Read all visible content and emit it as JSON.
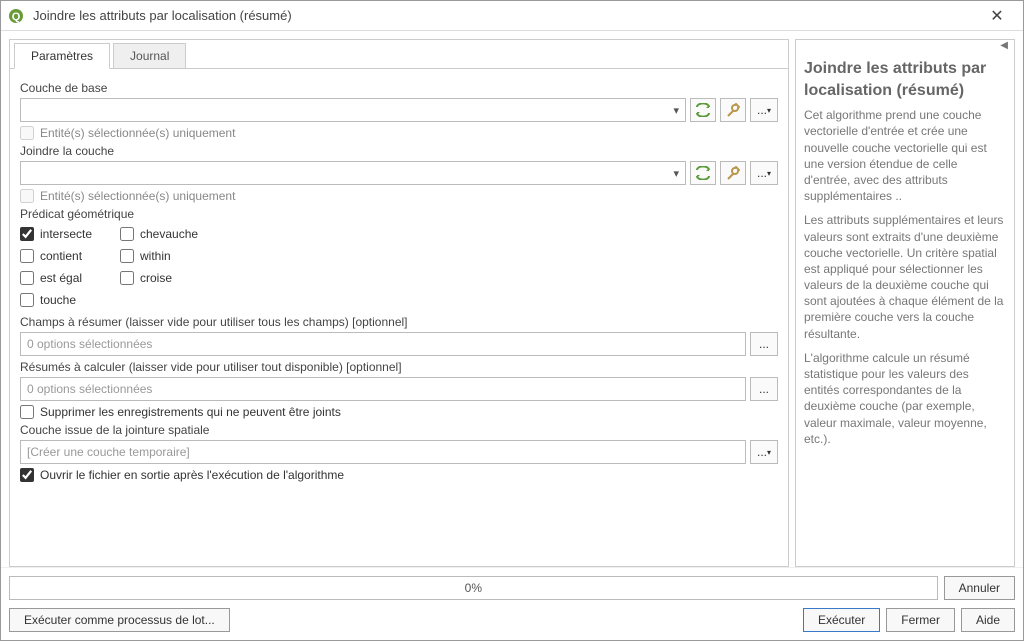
{
  "window": {
    "title": "Joindre les attributs par localisation (résumé)"
  },
  "tabs": {
    "parameters": "Paramètres",
    "log": "Journal"
  },
  "labels": {
    "base_layer": "Couche de base",
    "selected_only": "Entité(s) sélectionnée(s) uniquement",
    "join_layer": "Joindre la couche",
    "predicate": "Prédicat géométrique",
    "fields_summary": "Champs à résumer (laisser vide pour utiliser tous les champs) [optionnel]",
    "summaries": "Résumés à calculer (laisser vide pour utiliser tout disponible) [optionnel]",
    "remove_unjoined": "Supprimer les enregistrements qui ne peuvent être joints",
    "output_layer": "Couche issue de la jointure spatiale",
    "output_placeholder": "[Créer une couche temporaire]",
    "open_after": "Ouvrir le fichier en sortie après l'exécution de l'algorithme"
  },
  "predicates": {
    "intersects": "intersecte",
    "overlaps": "chevauche",
    "contains": "contient",
    "within": "within",
    "equals": "est égal",
    "crosses": "croise",
    "touches": "touche"
  },
  "options_placeholder": "0 options sélectionnées",
  "help": {
    "title": "Joindre les attributs par localisation (résumé)",
    "p1": "Cet algorithme prend une couche vectorielle d'entrée et crée une nouvelle couche vectorielle qui est une version étendue de celle d'entrée, avec des attributs supplémentaires ..",
    "p2": "Les attributs supplémentaires et leurs valeurs sont extraits d'une deuxième couche vectorielle. Un critère spatial est appliqué pour sélectionner les valeurs de la deuxième couche qui sont ajoutées à chaque élément de la première couche vers la couche résultante.",
    "p3": "L'algorithme calcule un résumé statistique pour les valeurs des entités correspondantes de la deuxième couche (par exemple, valeur maximale, valeur moyenne, etc.)."
  },
  "progress": "0%",
  "buttons": {
    "cancel": "Annuler",
    "batch": "Exécuter comme processus de lot...",
    "run": "Exécuter",
    "close": "Fermer",
    "help": "Aide"
  }
}
